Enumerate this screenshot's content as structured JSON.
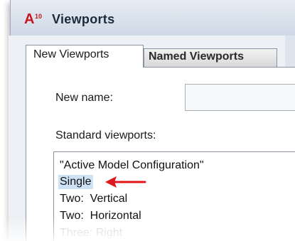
{
  "window": {
    "title": "Viewports",
    "icon": "autocad-app-icon"
  },
  "tabs": [
    {
      "label": "New Viewports",
      "active": true
    },
    {
      "label": "Named Viewports",
      "active": false
    }
  ],
  "form": {
    "new_name_label": "New name:",
    "new_name_value": "",
    "standard_viewports_label": "Standard viewports:"
  },
  "viewports_list": {
    "items": [
      "\"Active Model Configuration\"",
      "Single",
      "Two:  Vertical",
      "Two:  Horizontal",
      "Three: Right"
    ],
    "selected": "Single"
  },
  "annotation": {
    "arrow_color": "#e0161b",
    "selection_color": "#cde3f5"
  }
}
